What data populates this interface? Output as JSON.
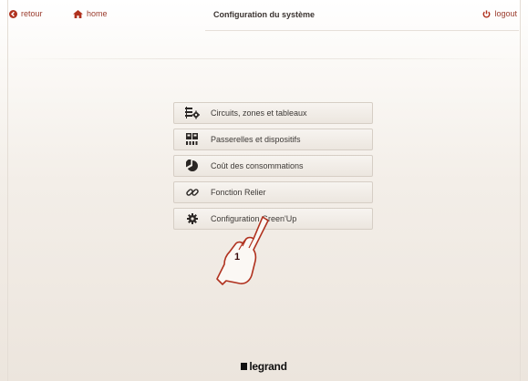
{
  "header": {
    "back_label": "retour",
    "home_label": "home",
    "title": "Configuration du système",
    "logout_label": "logout"
  },
  "menu": {
    "items": [
      {
        "label": "Circuits, zones et tableaux",
        "icon": "circuits-icon"
      },
      {
        "label": "Passerelles et dispositifs",
        "icon": "gateway-icon"
      },
      {
        "label": "Coût des consommations",
        "icon": "pie-chart-icon"
      },
      {
        "label": "Fonction Relier",
        "icon": "link-icon"
      },
      {
        "label": "Configuration Green'Up",
        "icon": "gear-icon"
      }
    ]
  },
  "callout": {
    "number": "1"
  },
  "footer": {
    "brand": "legrand"
  },
  "colors": {
    "accent": "#b0321f",
    "text": "#3d3936",
    "icon": "#2a2624"
  }
}
